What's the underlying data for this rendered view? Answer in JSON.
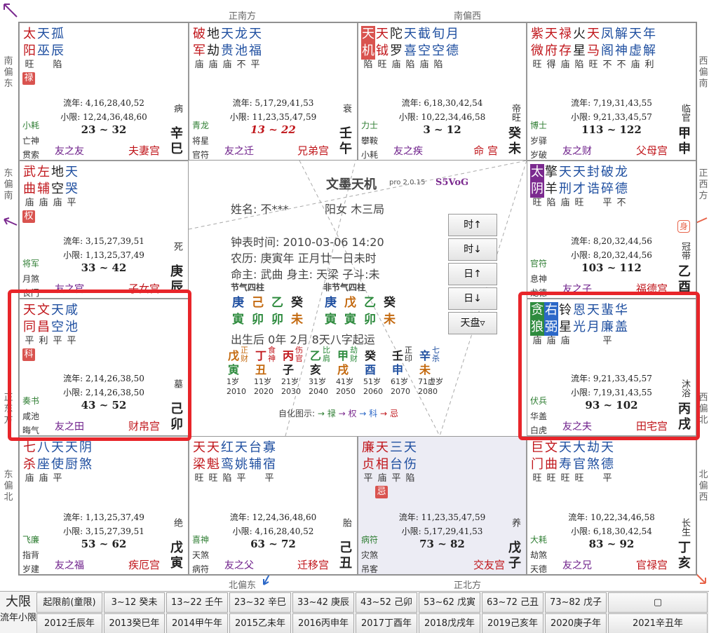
{
  "directions": {
    "top_left": "正南方",
    "top_right": "南偏西",
    "bottom_left": "北偏东",
    "bottom_right": "正北方",
    "left_top": "南偏东",
    "left_mid": "东偏南",
    "left_low": "正东方",
    "left_bottom": "东偏北",
    "right_top": "西偏南",
    "right_mid": "正西方",
    "right_low": "西偏北",
    "right_bottom": "北偏西"
  },
  "cells": [
    {
      "id": "si",
      "stars_top": [
        "太",
        "天",
        "孤"
      ],
      "stars_bot": [
        "阳",
        "巫",
        "辰"
      ],
      "top_colors": [
        "red",
        "blue",
        "blue"
      ],
      "bot_colors": [
        "red",
        "blue",
        "blue"
      ],
      "bright": [
        "旺",
        "",
        "陷"
      ],
      "badge": "禄",
      "liunian": "流年: 4,16,28,40,52",
      "xiaoxian": "小限: 12,24,36,48,60",
      "daxian": "23 ~ 32",
      "boshi": "小耗",
      "jiang": "亡神",
      "sui": "贯索",
      "guest": "友之友",
      "palace": "夫妻宫",
      "state": "病",
      "gz": [
        "辛",
        "巳"
      ]
    },
    {
      "id": "wu",
      "stars_top": [
        "破",
        "地",
        "天",
        "龙",
        "天"
      ],
      "stars_bot": [
        "军",
        "劫",
        "贵",
        "池",
        "福"
      ],
      "top_colors": [
        "red",
        "dark",
        "blue",
        "blue",
        "blue"
      ],
      "bot_colors": [
        "red",
        "dark",
        "blue",
        "blue",
        "blue"
      ],
      "bright": [
        "庙",
        "庙",
        "庙",
        "不",
        "平"
      ],
      "liunian": "流年: 5,17,29,41,53",
      "xiaoxian": "小限: 11,23,35,47,59",
      "daxian": "13 ~ 22",
      "boshi": "青龙",
      "jiang": "将星",
      "sui": "官符",
      "guest": "友之迁",
      "palace": "兄弟宫",
      "state": "衰",
      "gz": [
        "壬",
        "午"
      ]
    },
    {
      "id": "wei",
      "stars_top": [
        "天",
        "天",
        "陀",
        "天",
        "截",
        "旬",
        "月"
      ],
      "stars_bot": [
        "机",
        "钺",
        "罗",
        "喜",
        "空",
        "空",
        "德"
      ],
      "top_colors": [
        "hi",
        "red",
        "dark",
        "blue",
        "blue",
        "blue",
        "blue"
      ],
      "bot_colors": [
        "hi",
        "red",
        "dark",
        "blue",
        "blue",
        "blue",
        "blue"
      ],
      "bright": [
        "陷",
        "旺",
        "庙",
        "陷",
        "庙",
        "陷",
        ""
      ],
      "liunian": "流年: 6,18,30,42,54",
      "xiaoxian": "小限: 10,22,34,46,58",
      "daxian": "3 ~ 12",
      "boshi": "力士",
      "jiang": "攀鞍",
      "sui": "小耗",
      "guest": "友之疾",
      "palace": "命 宫",
      "state": "帝旺",
      "gz": [
        "癸",
        "未"
      ]
    },
    {
      "id": "shen",
      "stars_top": [
        "紫",
        "天",
        "禄",
        "火",
        "天",
        "凤",
        "解",
        "天",
        "年"
      ],
      "stars_bot": [
        "微",
        "府",
        "存",
        "星",
        "马",
        "阁",
        "神",
        "虚",
        "解"
      ],
      "top_colors": [
        "red",
        "red",
        "red",
        "dark",
        "red",
        "blue",
        "blue",
        "blue",
        "blue"
      ],
      "bot_colors": [
        "red",
        "red",
        "red",
        "dark",
        "red",
        "blue",
        "blue",
        "blue",
        "blue"
      ],
      "bright": [
        "旺",
        "得",
        "庙",
        "陷",
        "旺",
        "不",
        "不",
        "庙",
        "利"
      ],
      "liunian": "流年: 7,19,31,43,55",
      "xiaoxian": "小限: 9,21,33,45,57",
      "daxian": "113 ~ 122",
      "boshi": "博士",
      "jiang": "岁驿",
      "sui": "岁破",
      "guest": "友之财",
      "palace": "父母宫",
      "state": "临官",
      "gz": [
        "甲",
        "申"
      ]
    },
    {
      "id": "chen",
      "stars_top": [
        "武",
        "左",
        "地",
        "天"
      ],
      "stars_bot": [
        "曲",
        "辅",
        "空",
        "哭"
      ],
      "top_colors": [
        "red",
        "red",
        "dark",
        "blue"
      ],
      "bot_colors": [
        "red",
        "red",
        "dark",
        "blue"
      ],
      "bright": [
        "庙",
        "庙",
        "庙",
        "平"
      ],
      "badge": "权",
      "liunian": "流年: 3,15,27,39,51",
      "xiaoxian": "小限: 1,13,25,37,49",
      "daxian": "33 ~ 42",
      "boshi": "将军",
      "jiang": "月煞",
      "sui": "丧门",
      "guest": "友之官",
      "palace": "子女宫",
      "state": "死",
      "gz": [
        "庚",
        "辰"
      ]
    },
    {
      "id": "you",
      "stars_top": [
        "太",
        "擎",
        "天",
        "天",
        "封",
        "破",
        "龙"
      ],
      "stars_bot": [
        "阴",
        "羊",
        "刑",
        "才",
        "诰",
        "碎",
        "德"
      ],
      "top_colors": [
        "hi",
        "dark",
        "blue",
        "blue",
        "blue",
        "blue",
        "blue"
      ],
      "bot_colors": [
        "hi",
        "dark",
        "blue",
        "blue",
        "blue",
        "blue",
        "blue"
      ],
      "bright": [
        "旺",
        "陷",
        "庙",
        "旺",
        "",
        "平",
        "不"
      ],
      "shen_mark": "身",
      "liunian": "流年: 8,20,32,44,56",
      "xiaoxian": "小限: 8,20,32,44,56",
      "daxian": "103 ~ 112",
      "boshi": "官符",
      "jiang": "息神",
      "sui": "龙德",
      "guest": "友之子",
      "palace": "福德宫",
      "state": "冠带",
      "gz": [
        "乙",
        "酉"
      ]
    },
    {
      "id": "mao",
      "stars_top": [
        "天",
        "文",
        "天",
        "咸"
      ],
      "stars_bot": [
        "同",
        "昌",
        "空",
        "池"
      ],
      "top_colors": [
        "red",
        "red",
        "blue",
        "blue"
      ],
      "bot_colors": [
        "red",
        "red",
        "blue",
        "blue"
      ],
      "bright": [
        "平",
        "利",
        "平",
        "平"
      ],
      "badge": "科",
      "liunian": "流年: 2,14,26,38,50",
      "xiaoxian": "小限: 2,14,26,38,50",
      "daxian": "43 ~ 52",
      "boshi": "奏书",
      "jiang": "咸池",
      "sui": "晦气",
      "guest": "友之田",
      "palace": "财帛宫",
      "state": "墓",
      "gz": [
        "己",
        "卯"
      ]
    },
    {
      "id": "xu",
      "stars_top": [
        "贪",
        "右",
        "铃",
        "恩",
        "天",
        "蜚",
        "华"
      ],
      "stars_bot": [
        "狼",
        "弼",
        "星",
        "光",
        "月",
        "廉",
        "盖"
      ],
      "top_colors": [
        "hi",
        "hi",
        "dark",
        "blue",
        "blue",
        "blue",
        "blue"
      ],
      "bot_colors": [
        "hi",
        "hi",
        "dark",
        "blue",
        "blue",
        "blue",
        "blue"
      ],
      "bright": [
        "庙",
        "庙",
        "庙",
        "",
        "",
        "平",
        ""
      ],
      "liunian": "流年: 9,21,33,45,57",
      "xiaoxian": "小限: 7,19,31,43,55",
      "daxian": "93 ~ 102",
      "boshi": "伏兵",
      "jiang": "华盖",
      "sui": "白虎",
      "guest": "友之夫",
      "palace": "田宅宫",
      "state": "沐浴",
      "gz": [
        "丙",
        "戌"
      ]
    },
    {
      "id": "yin",
      "stars_top": [
        "七",
        "八",
        "天",
        "天",
        "阴"
      ],
      "stars_bot": [
        "杀",
        "座",
        "使",
        "厨",
        "煞"
      ],
      "top_colors": [
        "red",
        "blue",
        "blue",
        "blue",
        "blue"
      ],
      "bot_colors": [
        "red",
        "blue",
        "blue",
        "blue",
        "blue"
      ],
      "bright": [
        "庙",
        "庙",
        "平",
        "",
        ""
      ],
      "liunian": "流年: 1,13,25,37,49",
      "xiaoxian": "小限: 3,15,27,39,51",
      "daxian": "53 ~ 62",
      "boshi": "飞廉",
      "jiang": "指背",
      "sui": "岁建",
      "guest": "友之福",
      "palace": "疾厄宫",
      "state": "绝",
      "gz": [
        "戊",
        "寅"
      ]
    },
    {
      "id": "chou",
      "stars_top": [
        "天",
        "天",
        "红",
        "天",
        "台",
        "寡"
      ],
      "stars_bot": [
        "梁",
        "魁",
        "鸾",
        "姚",
        "辅",
        "宿"
      ],
      "top_colors": [
        "red",
        "red",
        "blue",
        "blue",
        "blue",
        "blue"
      ],
      "bot_colors": [
        "red",
        "red",
        "blue",
        "blue",
        "blue",
        "blue"
      ],
      "bright": [
        "旺",
        "旺",
        "陷",
        "平",
        "",
        "平"
      ],
      "liunian": "流年: 12,24,36,48,60",
      "xiaoxian": "小限: 4,16,28,40,52",
      "daxian": "63 ~ 72",
      "boshi": "喜神",
      "jiang": "天煞",
      "sui": "病符",
      "guest": "友之父",
      "palace": "迁移宫",
      "state": "胎",
      "gz": [
        "己",
        "丑"
      ]
    },
    {
      "id": "zi",
      "stars_top": [
        "廉",
        "天",
        "三",
        "天"
      ],
      "stars_bot": [
        "贞",
        "相",
        "台",
        "伤"
      ],
      "top_colors": [
        "red",
        "red",
        "blue",
        "blue"
      ],
      "bot_colors": [
        "red",
        "red",
        "blue",
        "blue"
      ],
      "bright": [
        "平",
        "庙",
        "平",
        "陷"
      ],
      "badge": "忌",
      "liunian": "流年: 11,23,35,47,59",
      "xiaoxian": "小限: 5,17,29,41,53",
      "daxian": "73 ~ 82",
      "boshi": "病符",
      "jiang": "灾煞",
      "sui": "吊客",
      "guest": "",
      "palace": "交友宫",
      "state": "养",
      "gz": [
        "戊",
        "子"
      ]
    },
    {
      "id": "hai",
      "stars_top": [
        "巨",
        "文",
        "天",
        "大",
        "劫",
        "天"
      ],
      "stars_bot": [
        "门",
        "曲",
        "寿",
        "官",
        "煞",
        "德"
      ],
      "top_colors": [
        "red",
        "red",
        "blue",
        "blue",
        "blue",
        "blue"
      ],
      "bot_colors": [
        "red",
        "red",
        "blue",
        "blue",
        "blue",
        "blue"
      ],
      "bright": [
        "旺",
        "旺",
        "旺",
        "旺",
        "",
        "平"
      ],
      "liunian": "流年: 10,22,34,46,58",
      "xiaoxian": "小限: 6,18,30,42,54",
      "daxian": "83 ~ 92",
      "boshi": "大耗",
      "jiang": "劫煞",
      "sui": "天德",
      "guest": "友之兄",
      "palace": "官禄宫",
      "state": "长生",
      "gz": [
        "丁",
        "亥"
      ]
    }
  ],
  "center": {
    "app": "文墨天机",
    "ver": "pro 2.0.15",
    "code": "S5VoG",
    "name": "姓名: 不***",
    "gender": "阳女 木三局",
    "clock": "钟表时间: 2010-03-06 14:20",
    "lunar": "农历: 庚寅年 正月廿一日未时",
    "ming": "命主: 武曲 身主: 天梁 子斗:未",
    "jq_title": "节气四柱",
    "fjq_title": "非节气四柱",
    "jq_top": [
      "庚",
      "己",
      "乙",
      "癸"
    ],
    "jq_bot": [
      "寅",
      "卯",
      "卯",
      "未"
    ],
    "fjq_top": [
      "庚",
      "戊",
      "乙",
      "癸"
    ],
    "fjq_bot": [
      "寅",
      "寅",
      "卯",
      "未"
    ],
    "start": "出生后 0年 2月 8天八字起运",
    "dayun": [
      {
        "g": "戊",
        "z": "寅",
        "s": "正财",
        "age": "1岁",
        "yr": "2010"
      },
      {
        "g": "丁",
        "z": "丑",
        "s": "食神",
        "age": "11岁",
        "yr": "2020"
      },
      {
        "g": "丙",
        "z": "子",
        "s": "伤官",
        "age": "21岁",
        "yr": "2030"
      },
      {
        "g": "乙",
        "z": "亥",
        "s": "比肩",
        "age": "31岁",
        "yr": "2040"
      },
      {
        "g": "甲",
        "z": "戌",
        "s": "劫财",
        "age": "41岁",
        "yr": "2050"
      },
      {
        "g": "癸",
        "z": "酉",
        "s": "",
        "age": "51岁",
        "yr": "2060"
      },
      {
        "g": "壬",
        "z": "申",
        "s": "正印",
        "age": "61岁",
        "yr": "2070"
      },
      {
        "g": "辛",
        "z": "未",
        "s": "七杀",
        "age": "71虚岁",
        "yr": "2080"
      }
    ],
    "legend_label": "自化图示:",
    "legend": [
      "→ 禄",
      "→ 权",
      "→ 科",
      "→ 忌"
    ],
    "buttons": [
      "时↑",
      "时↓",
      "日↑",
      "日↓",
      "天盘▿"
    ]
  },
  "bottom": {
    "row1_label": "大限",
    "row2_label": "流年小限",
    "row1": [
      "起限前(童限)",
      "3~12 癸未",
      "13~22 壬午",
      "23~32 辛巳",
      "33~42 庚辰",
      "43~52 己卯",
      "53~62 戊寅",
      "63~72 己丑",
      "73~82 戊子",
      "▢"
    ],
    "row2": [
      "2012壬辰年",
      "2013癸巳年",
      "2014甲午年",
      "2015乙未年",
      "2016丙申年",
      "2017丁酉年",
      "2018戊戌年",
      "2019己亥年",
      "2020庚子年",
      "2021辛丑年"
    ]
  }
}
